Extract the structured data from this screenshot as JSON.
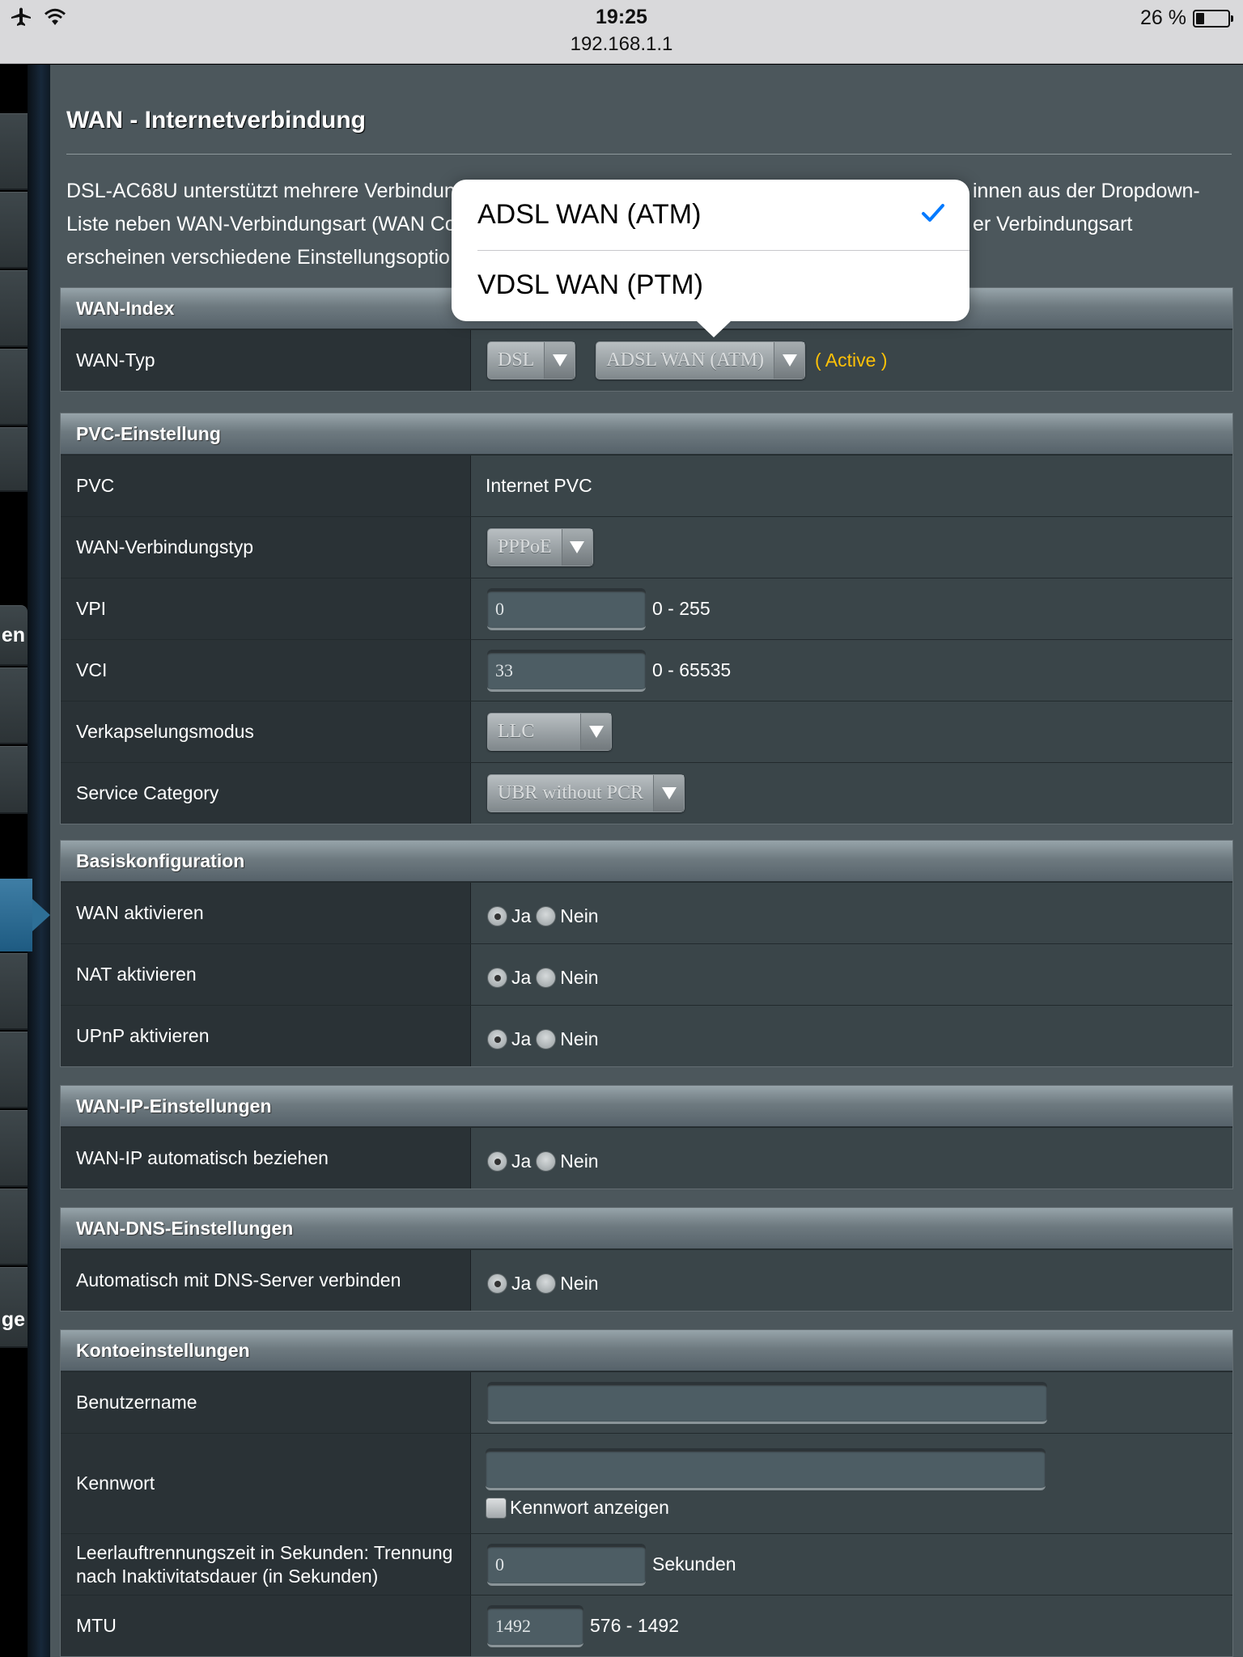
{
  "status_bar": {
    "time": "19:25",
    "url": "192.168.1.1",
    "battery": "26 %",
    "battery_level": 0.26
  },
  "side_menu": {
    "partial_labels": [
      "en",
      "ge"
    ]
  },
  "page": {
    "title": "WAN - Internetverbindung",
    "description_lines": [
      "DSL-AC68U unterstützt mehrere Verbindun",
      "Liste neben WAN-Verbindungsart (WAN Co",
      "erscheinen verschiedene Einstellungsoptio"
    ],
    "description_right": [
      "innen aus der Dropdown-",
      "er Verbindungsart",
      ""
    ]
  },
  "picker": {
    "options": [
      "ADSL WAN (ATM)",
      "VDSL WAN (PTM)"
    ],
    "selected_index": 0,
    "check_icon": "checkmark-icon",
    "accent": "#007aff"
  },
  "wan_index": {
    "header": "WAN-Index",
    "wan_type_label": "WAN-Typ",
    "type_select": "DSL",
    "mode_select": "ADSL WAN (ATM)",
    "status": "( Active )",
    "status_color": "#ffc107"
  },
  "pvc": {
    "header": "PVC-Einstellung",
    "pvc_label": "PVC",
    "pvc_value": "Internet PVC",
    "conn_type_label": "WAN-Verbindungstyp",
    "conn_type_value": "PPPoE",
    "vpi_label": "VPI",
    "vpi_value": "0",
    "vpi_range": "0 - 255",
    "vci_label": "VCI",
    "vci_value": "33",
    "vci_range": "0 - 65535",
    "encap_label": "Verkapselungsmodus",
    "encap_value": "LLC",
    "service_label": "Service Category",
    "service_value": "UBR without PCR"
  },
  "basic": {
    "header": "Basiskonfiguration",
    "yes": "Ja",
    "no": "Nein",
    "wan_enable": "WAN aktivieren",
    "nat_enable": "NAT aktivieren",
    "upnp_enable": "UPnP aktivieren"
  },
  "wan_ip": {
    "header": "WAN-IP-Einstellungen",
    "auto_label": "WAN-IP automatisch beziehen"
  },
  "wan_dns": {
    "header": "WAN-DNS-Einstellungen",
    "auto_label": "Automatisch mit DNS-Server verbinden"
  },
  "account": {
    "header": "Kontoeinstellungen",
    "username_label": "Benutzername",
    "username_value": "",
    "password_label": "Kennwort",
    "password_value": "",
    "show_password": "Kennwort anzeigen",
    "idle_label_1": "Leerlauftrennungszeit in Sekunden: Trennung",
    "idle_label_2": "nach Inaktivitatsdauer (in Sekunden)",
    "idle_value": "0",
    "idle_unit": "Sekunden",
    "mtu_label": "MTU",
    "mtu_value": "1492",
    "mtu_range": "576 - 1492"
  }
}
